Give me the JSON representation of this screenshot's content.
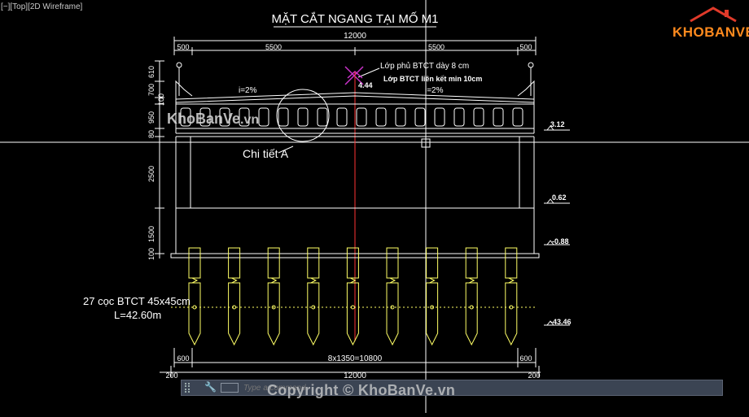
{
  "viewport": {
    "label": "[−][Top][2D Wireframe]"
  },
  "drawing": {
    "title": "MẶT CẮT NGANG TẠI MỐ M1",
    "dim_top_total": "12000",
    "dim_top_left_edge": "500",
    "dim_top_left_span": "5500",
    "dim_top_right_span": "5500",
    "dim_top_right_edge": "500",
    "note_overlay": "Lớp phủ BTCT dày 8 cm",
    "note_layer": "Lớp BTCT liên kết min 10cm",
    "slope_left": "i=2%",
    "slope_right": "i=2%",
    "crest_level": "4.44",
    "detail_label": "Chi tiết A",
    "left_dims": [
      "610",
      "700",
      "100",
      "950",
      "80",
      "2500",
      "1500",
      "100"
    ],
    "right_levels": [
      "3.12",
      "0.62",
      "-0.88",
      "-43.46"
    ],
    "pile_note_line1": "27 cọc BTCT 45x45cm",
    "pile_note_line2": "L=42.60m",
    "dim_bottom_left": "600",
    "dim_bottom_middle": "8x1350=10800",
    "dim_bottom_right": "600",
    "dim_base_left": "200",
    "dim_base_total": "12000",
    "dim_base_right": "200"
  },
  "command_line": {
    "placeholder": "Type a command"
  },
  "watermarks": {
    "center": "Copyright © KhoBanVe.vn",
    "left_name": "KhoBanVe",
    "left_suffix": ".vn",
    "logo_a": "KHOBAN",
    "logo_b": "VE"
  },
  "colors": {
    "background": "#000000",
    "lines": "#ffffff",
    "piles": "#ffff66",
    "axis": "#ff3333",
    "marker": "#cc33cc",
    "logo": "#ff8a1e"
  }
}
